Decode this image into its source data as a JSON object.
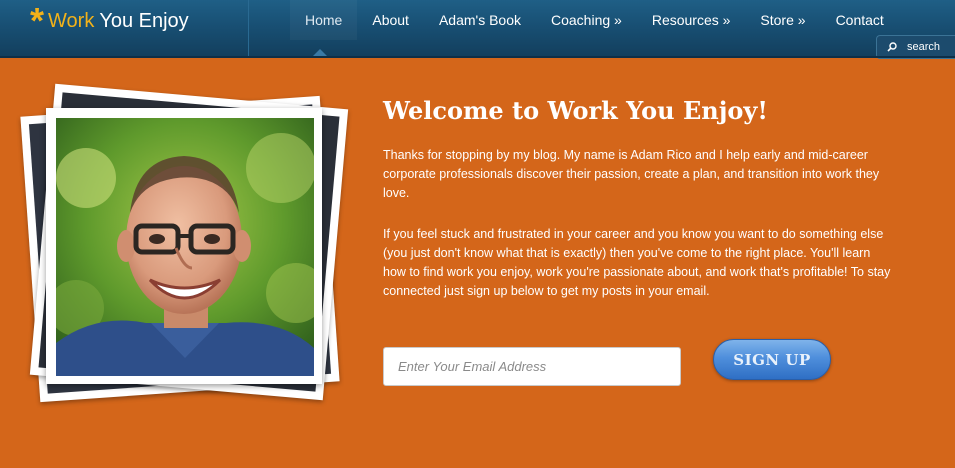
{
  "header": {
    "logo_work": "Work",
    "logo_rest": "You Enjoy",
    "nav": [
      {
        "label": "Home"
      },
      {
        "label": "About"
      },
      {
        "label": "Adam's Book"
      },
      {
        "label": "Coaching »"
      },
      {
        "label": "Resources »"
      },
      {
        "label": "Store »"
      },
      {
        "label": "Contact"
      }
    ],
    "search_label": "search",
    "search_icon": "magnifier-icon"
  },
  "main": {
    "headline": "Welcome to Work You Enjoy!",
    "paragraph1": "Thanks for stopping by my blog. My name is Adam Rico and I help early and mid-career corporate professionals discover their passion, create a plan, and transition into work they love.",
    "paragraph2": "If you feel stuck and frustrated in your career and you know you want to do something else (you just don't know what that is exactly) then you've come to the right place. You'll learn how to find work you enjoy, work you're passionate about, and work that's profitable! To stay connected just sign up below to get my posts in your email.",
    "email_placeholder": "Enter Your Email Address",
    "signup_label": "SIGN UP"
  },
  "colors": {
    "background": "#d4661a",
    "header": "#184f73",
    "logo_accent": "#f2b21a",
    "button": "#4f8fdc"
  }
}
